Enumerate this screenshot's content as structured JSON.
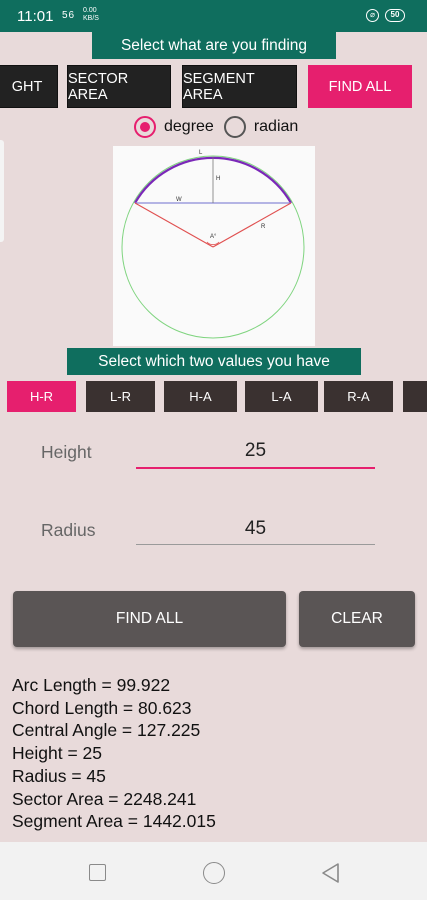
{
  "status": {
    "time": "11:01",
    "network": "56",
    "speed_value": "0.00",
    "speed_unit": "KB/S",
    "battery": "50"
  },
  "headers": {
    "finding": "Select what are you finding",
    "values": "Select which two values you have"
  },
  "find_tabs": [
    "GHT",
    "SECTOR AREA",
    "SEGMENT AREA",
    "FIND ALL"
  ],
  "unit": {
    "degree": "degree",
    "radian": "radian",
    "selected": "degree"
  },
  "diagram": {
    "l_label": "L",
    "h_label": "H",
    "w_label": "W",
    "r_label": "R",
    "a_label": "A°"
  },
  "pairs": [
    "H-R",
    "L-R",
    "H-A",
    "L-A",
    "R-A"
  ],
  "inputs": {
    "height": {
      "label": "Height",
      "value": "25"
    },
    "radius": {
      "label": "Radius",
      "value": "45"
    }
  },
  "buttons": {
    "find_all": "FIND ALL",
    "clear": "CLEAR"
  },
  "results": [
    "Arc Length = 99.922",
    "Chord Length = 80.623",
    "Central Angle = 127.225",
    "Height = 25",
    "Radius = 45",
    "Sector Area = 2248.241",
    "Segment Area = 1442.015"
  ],
  "colors": {
    "teal": "#0f6e5e",
    "accent": "#e61f6e",
    "background": "#e8dada"
  }
}
